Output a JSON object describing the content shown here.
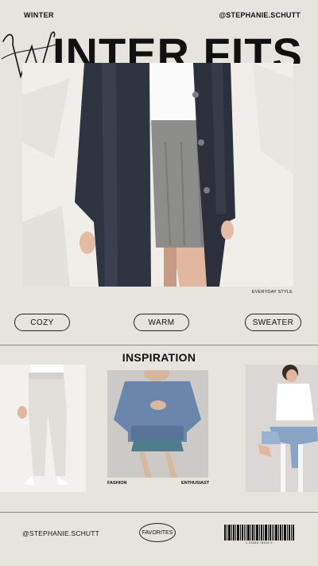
{
  "header": {
    "left_label": "WINTER",
    "right_handle": "@STEPHANIE.SCHUTT"
  },
  "hero": {
    "title_initial": "W",
    "title_rest": "INTER FITS",
    "caption": "EVERYDAY STYLE"
  },
  "tags": [
    {
      "label": "COZY"
    },
    {
      "label": "WARM"
    },
    {
      "label": "SWEATER"
    }
  ],
  "inspiration": {
    "title": "INSPIRATION",
    "captions": [
      "FASHION",
      "ENTHUSIAST"
    ]
  },
  "footer": {
    "handle": "@STEPHANIE.SCHUTT",
    "favorites_label": "FAVORITES",
    "barcode_number": "1 23456 78910 9"
  },
  "colors": {
    "background": "#e6e5dd",
    "ink": "#111111",
    "rule": "#8a8a86"
  }
}
